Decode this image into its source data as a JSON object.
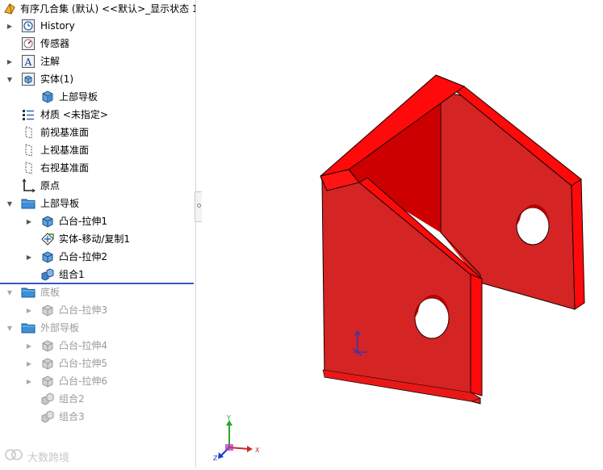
{
  "tree": {
    "title": "有序几合集 (默认) <<默认>_显示状态 1",
    "items": [
      {
        "label": "History",
        "icon": "history-icon",
        "expander": "collapsed"
      },
      {
        "label": "传感器",
        "icon": "sensor-icon",
        "expander": "none"
      },
      {
        "label": "注解",
        "icon": "annotation-icon",
        "expander": "collapsed"
      },
      {
        "label": "实体(1)",
        "icon": "solid-bodies-folder-icon",
        "expander": "expanded"
      },
      {
        "label": "上部导板",
        "icon": "solid-body-icon",
        "expander": "none"
      },
      {
        "label": "材质 <未指定>",
        "icon": "material-icon",
        "expander": "none"
      },
      {
        "label": "前视基准面",
        "icon": "plane-icon",
        "expander": "none"
      },
      {
        "label": "上视基准面",
        "icon": "plane-icon",
        "expander": "none"
      },
      {
        "label": "右视基准面",
        "icon": "plane-icon",
        "expander": "none"
      },
      {
        "label": "原点",
        "icon": "origin-icon",
        "expander": "none"
      },
      {
        "label": "上部导板",
        "icon": "folder-icon",
        "expander": "expanded"
      },
      {
        "label": "凸台-拉伸1",
        "icon": "extrude-icon",
        "expander": "collapsed"
      },
      {
        "label": "实体-移动/复制1",
        "icon": "move-copy-icon",
        "expander": "none"
      },
      {
        "label": "凸台-拉伸2",
        "icon": "extrude-icon",
        "expander": "collapsed"
      },
      {
        "label": "组合1",
        "icon": "combine-icon",
        "expander": "none"
      },
      {
        "label": "底板",
        "icon": "folder-icon",
        "expander": "expanded"
      },
      {
        "label": "凸台-拉伸3",
        "icon": "extrude-icon",
        "expander": "collapsed"
      },
      {
        "label": "外部导板",
        "icon": "folder-icon",
        "expander": "expanded"
      },
      {
        "label": "凸台-拉伸4",
        "icon": "extrude-icon",
        "expander": "collapsed"
      },
      {
        "label": "凸台-拉伸5",
        "icon": "extrude-icon",
        "expander": "collapsed"
      },
      {
        "label": "凸台-拉伸6",
        "icon": "extrude-icon",
        "expander": "collapsed"
      },
      {
        "label": "组合2",
        "icon": "combine-icon",
        "expander": "none"
      },
      {
        "label": "组合3",
        "icon": "combine-icon",
        "expander": "none"
      }
    ]
  },
  "triad": {
    "x": "X",
    "y": "Y",
    "z": "Z"
  },
  "watermark": "大数跨境",
  "colors": {
    "part_face": "#e02020",
    "part_front": "#d42424",
    "part_edge": "#ff0a0a",
    "part_inner": "#cc0000",
    "rollback_bar": "#3a55c7"
  }
}
